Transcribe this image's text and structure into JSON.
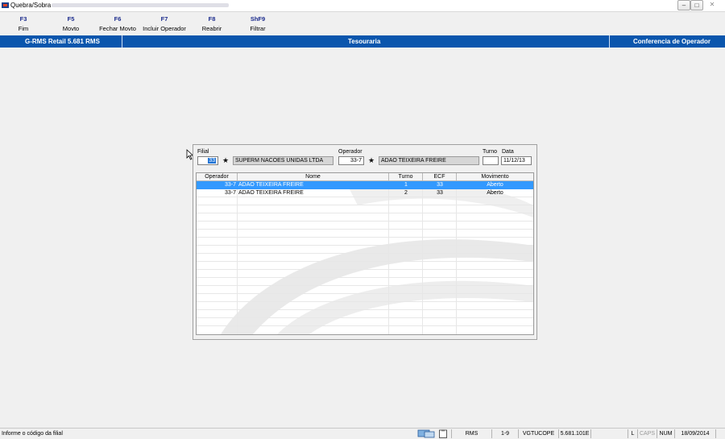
{
  "window": {
    "title": "Quebra/Sobra"
  },
  "toolbar": {
    "items": [
      {
        "key": "F3",
        "label": "Fim"
      },
      {
        "key": "F5",
        "label": "Movto"
      },
      {
        "key": "F6",
        "label": "Fechar Movto"
      },
      {
        "key": "F7",
        "label": "Incluir Operador"
      },
      {
        "key": "F8",
        "label": "Reabrir"
      },
      {
        "key": "ShF9",
        "label": "Filtrar"
      }
    ]
  },
  "band": {
    "left": "G-RMS Retail 5.681 RMS",
    "center": "Tesouraria",
    "right": "Conferencia de Operador"
  },
  "form": {
    "filial_label": "Filial",
    "filial_value": "33",
    "filial_name": "SUPERM NACOES UNIDAS LTDA",
    "operador_label": "Operador",
    "operador_value": "33-7",
    "operador_name": "ADAO TEIXEIRA FREIRE",
    "turno_label": "Turno",
    "turno_value": "",
    "data_label": "Data",
    "data_value": "11/12/13"
  },
  "grid": {
    "columns": [
      "Operador",
      "Nome",
      "Turno",
      "ECF",
      "Movimento"
    ],
    "rows": [
      {
        "operador": "33-7",
        "nome": "ADAO TEIXEIRA FREIRE",
        "turno": "1",
        "ecf": "33",
        "movimento": "Aberto"
      },
      {
        "operador": "33-7",
        "nome": "ADAO TEIXEIRA FREIRE",
        "turno": "2",
        "ecf": "33",
        "movimento": "Aberto"
      }
    ]
  },
  "status": {
    "message": "Informe o código da filial",
    "system": "RMS",
    "page": "1-9",
    "user": "VGTUCOPE",
    "version": "5.681.101E",
    "l": "L",
    "caps": "CAPS",
    "num": "NUM",
    "date": "18/09/2014"
  },
  "colors": {
    "band": "#0a56ad",
    "selection": "#3399ff",
    "fkey": "#1a2a8c"
  }
}
